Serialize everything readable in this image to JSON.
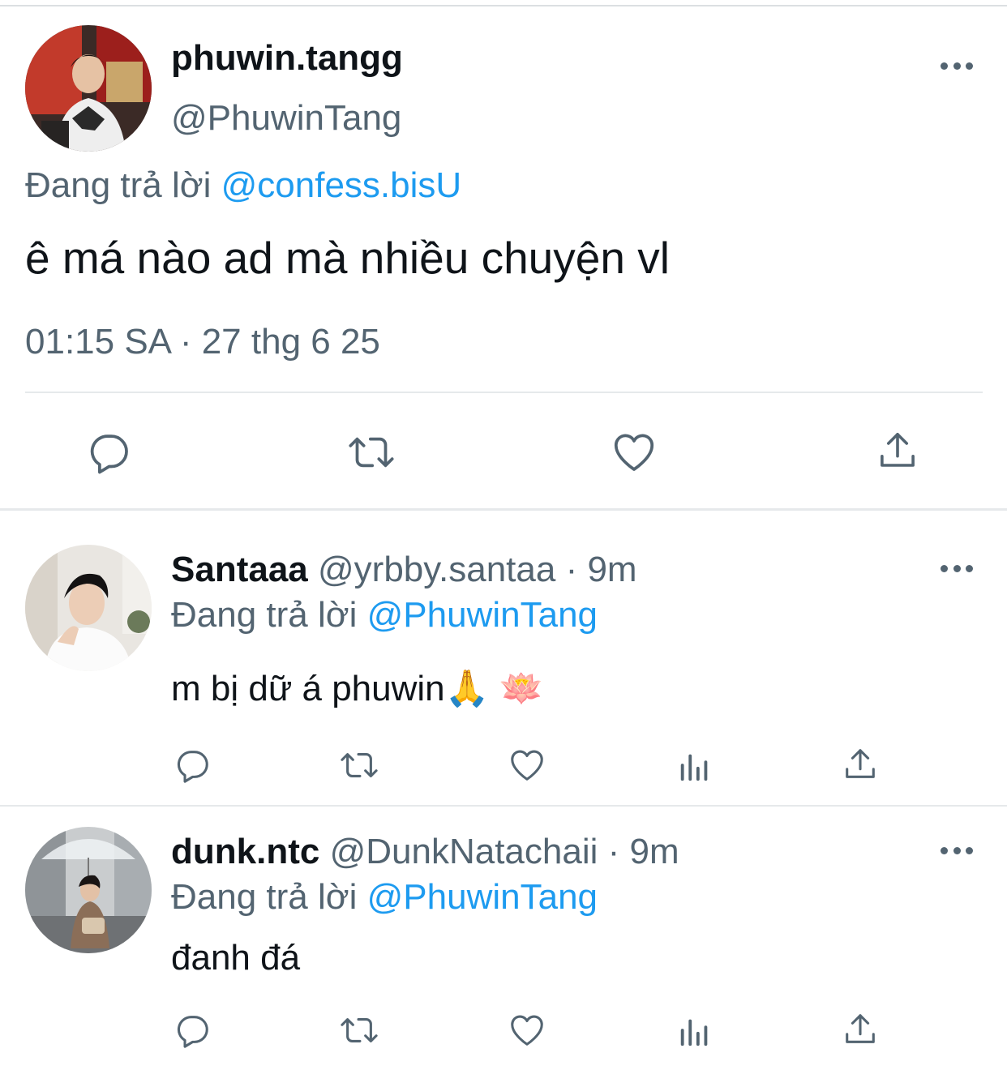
{
  "main_tweet": {
    "display_name": "phuwin.tangg",
    "handle": "@PhuwinTang",
    "replying_prefix": "Đang trả lời",
    "replying_to": "@confess.bisU",
    "text": "ê má nào ad mà nhiều chuyện vl",
    "timestamp": "01:15 SA · 27 thg 6 25",
    "actions": [
      "reply-icon",
      "retweet-icon",
      "like-icon",
      "share-icon"
    ]
  },
  "replies": [
    {
      "display_name": "Santaaa",
      "handle": "@yrbby.santaa",
      "time": "· 9m",
      "replying_prefix": "Đang trả lời",
      "replying_to": "@PhuwinTang",
      "text": "m bị dữ á phuwin🙏 🪷",
      "actions": [
        "reply-icon",
        "retweet-icon",
        "like-icon",
        "views-icon",
        "share-icon"
      ]
    },
    {
      "display_name": "dunk.ntc",
      "handle": "@DunkNatachaii",
      "time": "· 9m",
      "replying_prefix": "Đang trả lời",
      "replying_to": "@PhuwinTang",
      "text": "đanh đá",
      "actions": [
        "reply-icon",
        "retweet-icon",
        "like-icon",
        "views-icon",
        "share-icon"
      ]
    }
  ],
  "colors": {
    "link": "#1d9bf0",
    "secondary_text": "#536471",
    "primary_text": "#0f1419",
    "divider": "#e6e9eb"
  }
}
